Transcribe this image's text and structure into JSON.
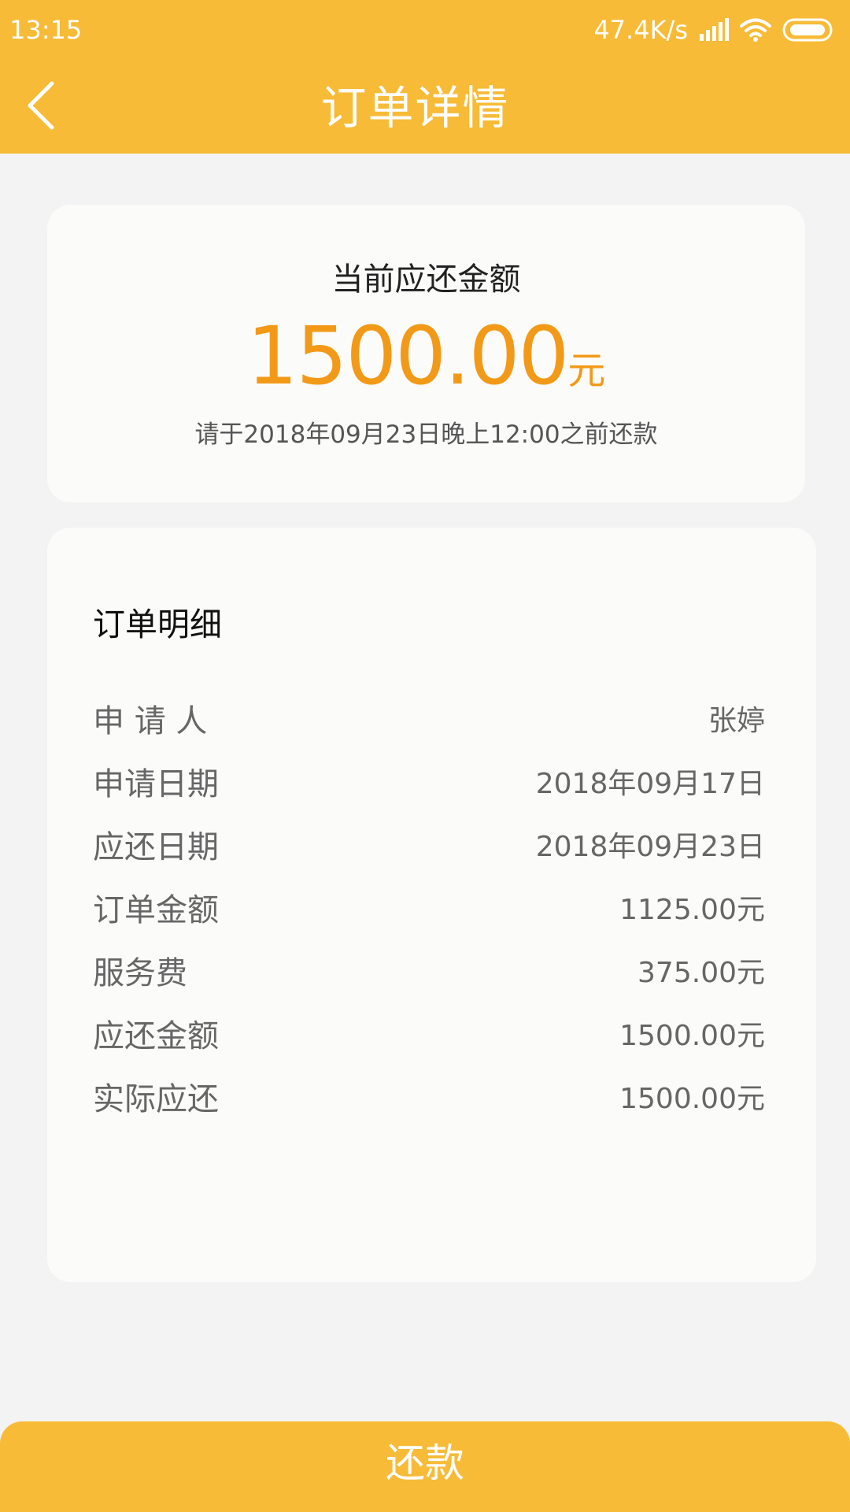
{
  "status_bar": {
    "time": "13:15",
    "network_speed": "47.4K/s",
    "icons": [
      "signal-icon",
      "wifi-icon",
      "battery-icon"
    ]
  },
  "header": {
    "back_icon": "chevron-left-icon",
    "title": "订单详情"
  },
  "summary": {
    "label": "当前应还金额",
    "amount": "1500.00",
    "unit": "元",
    "note": "请于2018年09月23日晚上12:00之前还款"
  },
  "details": {
    "title": "订单明细",
    "rows": [
      {
        "label": "申 请 人",
        "value": "张婷"
      },
      {
        "label": "申请日期",
        "value": "2018年09月17日"
      },
      {
        "label": "应还日期",
        "value": "2018年09月23日"
      },
      {
        "label": "订单金额",
        "value": "1125.00元"
      },
      {
        "label": "服务费",
        "value": "375.00元"
      },
      {
        "label": "应还金额",
        "value": "1500.00元"
      },
      {
        "label": "实际应还",
        "value": "1500.00元"
      }
    ]
  },
  "action": {
    "repay_label": "还款"
  },
  "colors": {
    "brand": "#f7bb37",
    "amount": "#f29a18",
    "background": "#f3f3f3",
    "card": "#fbfbfa",
    "text_secondary": "#666666"
  }
}
